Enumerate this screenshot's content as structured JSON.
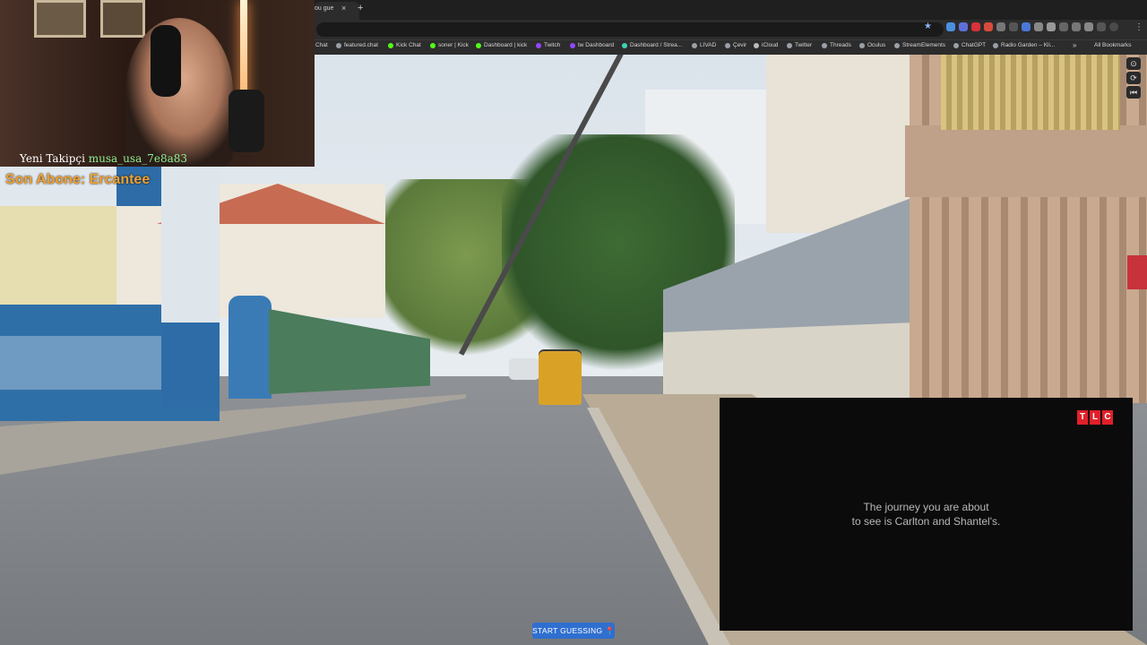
{
  "browser": {
    "tab_title": "ou gue",
    "tab_close": "×",
    "new_tab": "+",
    "star_icon": "★",
    "menu_icon": "⋮",
    "bookmarks": [
      {
        "label": "Chat",
        "icon": "none",
        "color": "#888888"
      },
      {
        "label": "featured.chat",
        "icon": "globe-icon",
        "color": "#9aa0a6"
      },
      {
        "label": "Kick Chat",
        "icon": "kick-icon",
        "color": "#53fc18"
      },
      {
        "label": "soner | Kick",
        "icon": "kick-icon",
        "color": "#53fc18"
      },
      {
        "label": "Dashboard | kick",
        "icon": "kick-icon",
        "color": "#53fc18"
      },
      {
        "label": "Twitch",
        "icon": "twitch-icon",
        "color": "#9146ff"
      },
      {
        "label": "tw Dashboard",
        "icon": "twitch-icon",
        "color": "#9146ff"
      },
      {
        "label": "Dashboard / Strea...",
        "icon": "streamelements-icon",
        "color": "#3fd1b1"
      },
      {
        "label": "LIVAD",
        "icon": "globe-icon",
        "color": "#9aa0a6"
      },
      {
        "label": "Çevir",
        "icon": "globe-icon",
        "color": "#9aa0a6"
      },
      {
        "label": "iCloud",
        "icon": "apple-icon",
        "color": "#bbbbbb"
      },
      {
        "label": "Twitter",
        "icon": "globe-icon",
        "color": "#9aa0a6"
      },
      {
        "label": "Threads",
        "icon": "globe-icon",
        "color": "#9aa0a6"
      },
      {
        "label": "Oculus",
        "icon": "globe-icon",
        "color": "#9aa0a6"
      },
      {
        "label": "StreamElements",
        "icon": "globe-icon",
        "color": "#9aa0a6"
      },
      {
        "label": "ChatGPT",
        "icon": "globe-icon",
        "color": "#9aa0a6"
      },
      {
        "label": "Radio Garden – Kli...",
        "icon": "globe-icon",
        "color": "#9aa0a6"
      }
    ],
    "bookmarks_more": "»",
    "all_bookmarks": "All Bookmarks"
  },
  "overlay": {
    "follower_label": "Yeni Takipçi",
    "follower_name": "musa_usa_7e8a83",
    "subscriber_text": "Son Abone: Ercantee"
  },
  "tools": {
    "compass_icon": "⊙",
    "refresh_icon": "⟳",
    "back_icon": "⏮"
  },
  "video": {
    "brand_letters": [
      "T",
      "L",
      "C"
    ],
    "caption_line1": "The journey you are about",
    "caption_line2": "to see is Carlton and Shantel's."
  },
  "game": {
    "start_button": "START GUESSING",
    "pin_icon": "📍"
  },
  "colors": {
    "brand_red": "#e0202a",
    "button_blue": "#2f6fd0",
    "subscriber_orange": "#f0a030",
    "follower_green": "#8ff08f"
  }
}
